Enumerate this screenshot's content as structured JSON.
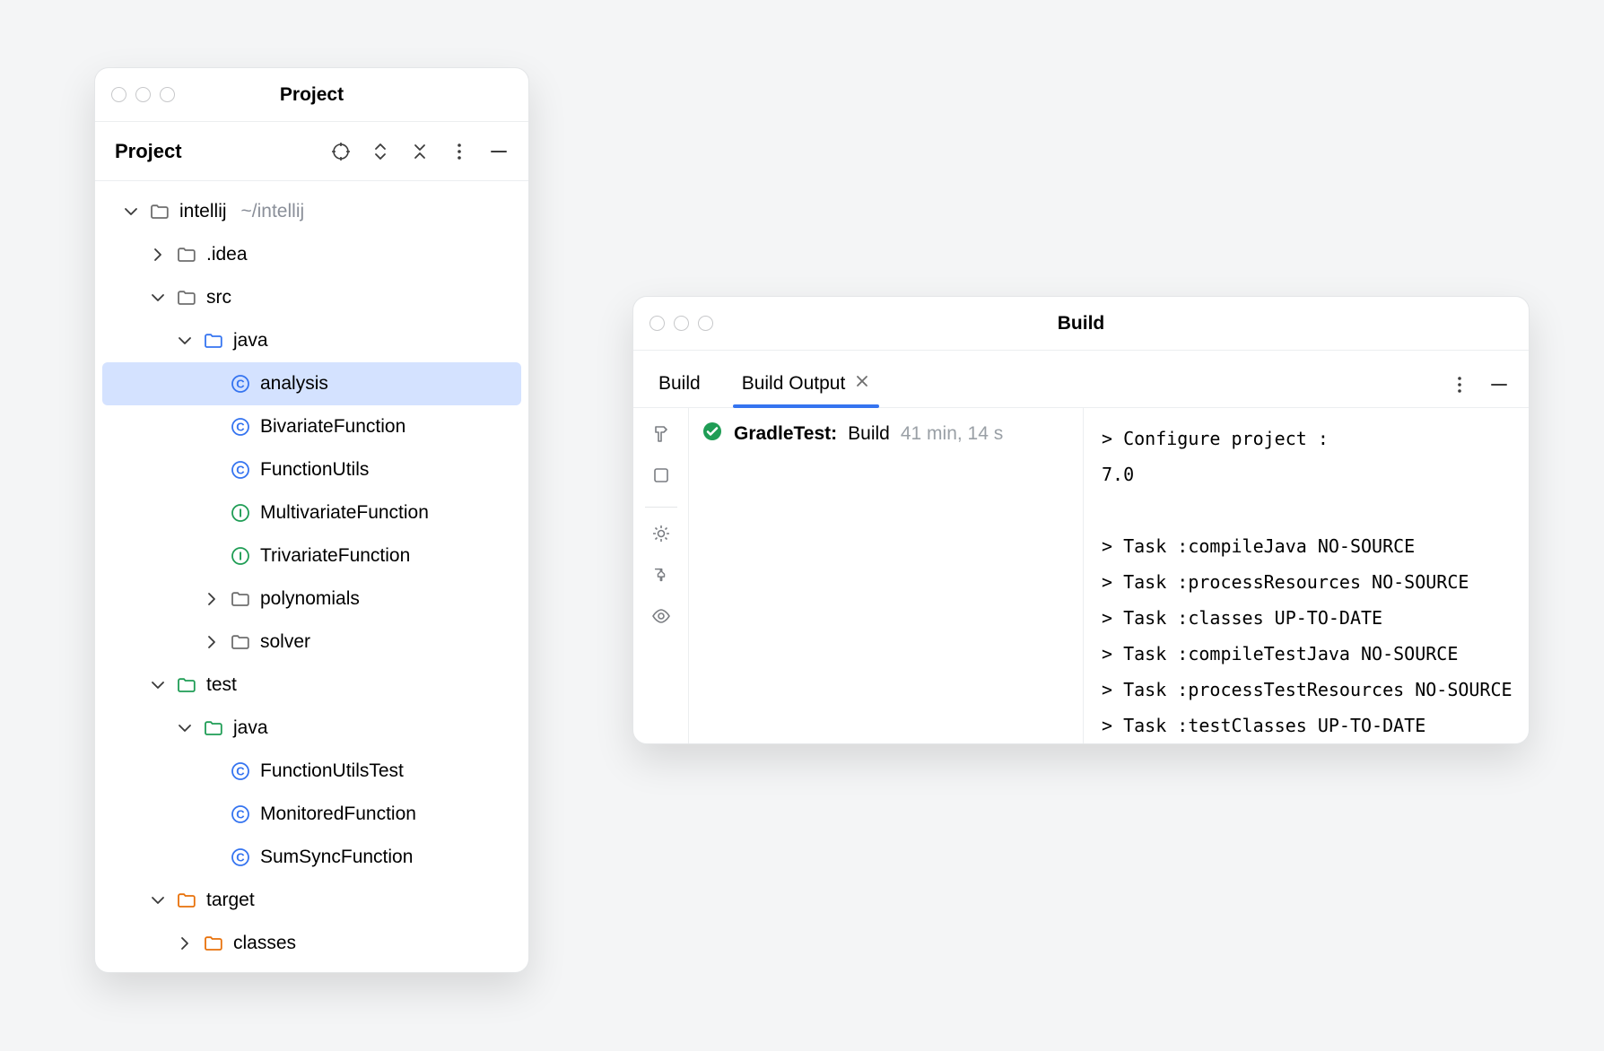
{
  "project_panel": {
    "title": "Project",
    "toolbar_label": "Project",
    "tree": {
      "root": {
        "name": "intellij",
        "path": "~/intellij"
      },
      "idea": {
        "name": ".idea"
      },
      "src": {
        "name": "src"
      },
      "java": {
        "name": "java"
      },
      "analysis": {
        "name": "analysis"
      },
      "bivariate": {
        "name": "BivariateFunction"
      },
      "funcutils": {
        "name": "FunctionUtils"
      },
      "multivar": {
        "name": "MultivariateFunction"
      },
      "trivar": {
        "name": "TrivariateFunction"
      },
      "polynomials": {
        "name": "polynomials"
      },
      "solver": {
        "name": "solver"
      },
      "test": {
        "name": "test"
      },
      "testjava": {
        "name": "java"
      },
      "futest": {
        "name": "FunctionUtilsTest"
      },
      "monitored": {
        "name": "MonitoredFunction"
      },
      "sumsync": {
        "name": "SumSyncFunction"
      },
      "target": {
        "name": "target"
      },
      "classes": {
        "name": "classes"
      }
    }
  },
  "build_panel": {
    "title": "Build",
    "tabs": {
      "build_label": "Build",
      "build_output_label": "Build Output"
    },
    "task": {
      "name": "GradleTest:",
      "status": "Build",
      "duration": "41 min, 14 s"
    },
    "console": {
      "l0": "> Configure project :",
      "l1": "7.0",
      "l2": "",
      "l3": "> Task :compileJava NO-SOURCE",
      "l4": "> Task :processResources NO-SOURCE",
      "l5": "> Task :classes UP-TO-DATE",
      "l6": "> Task :compileTestJava NO-SOURCE",
      "l7": "> Task :processTestResources NO-SOURCE",
      "l8": "> Task :testClasses UP-TO-DATE"
    }
  }
}
